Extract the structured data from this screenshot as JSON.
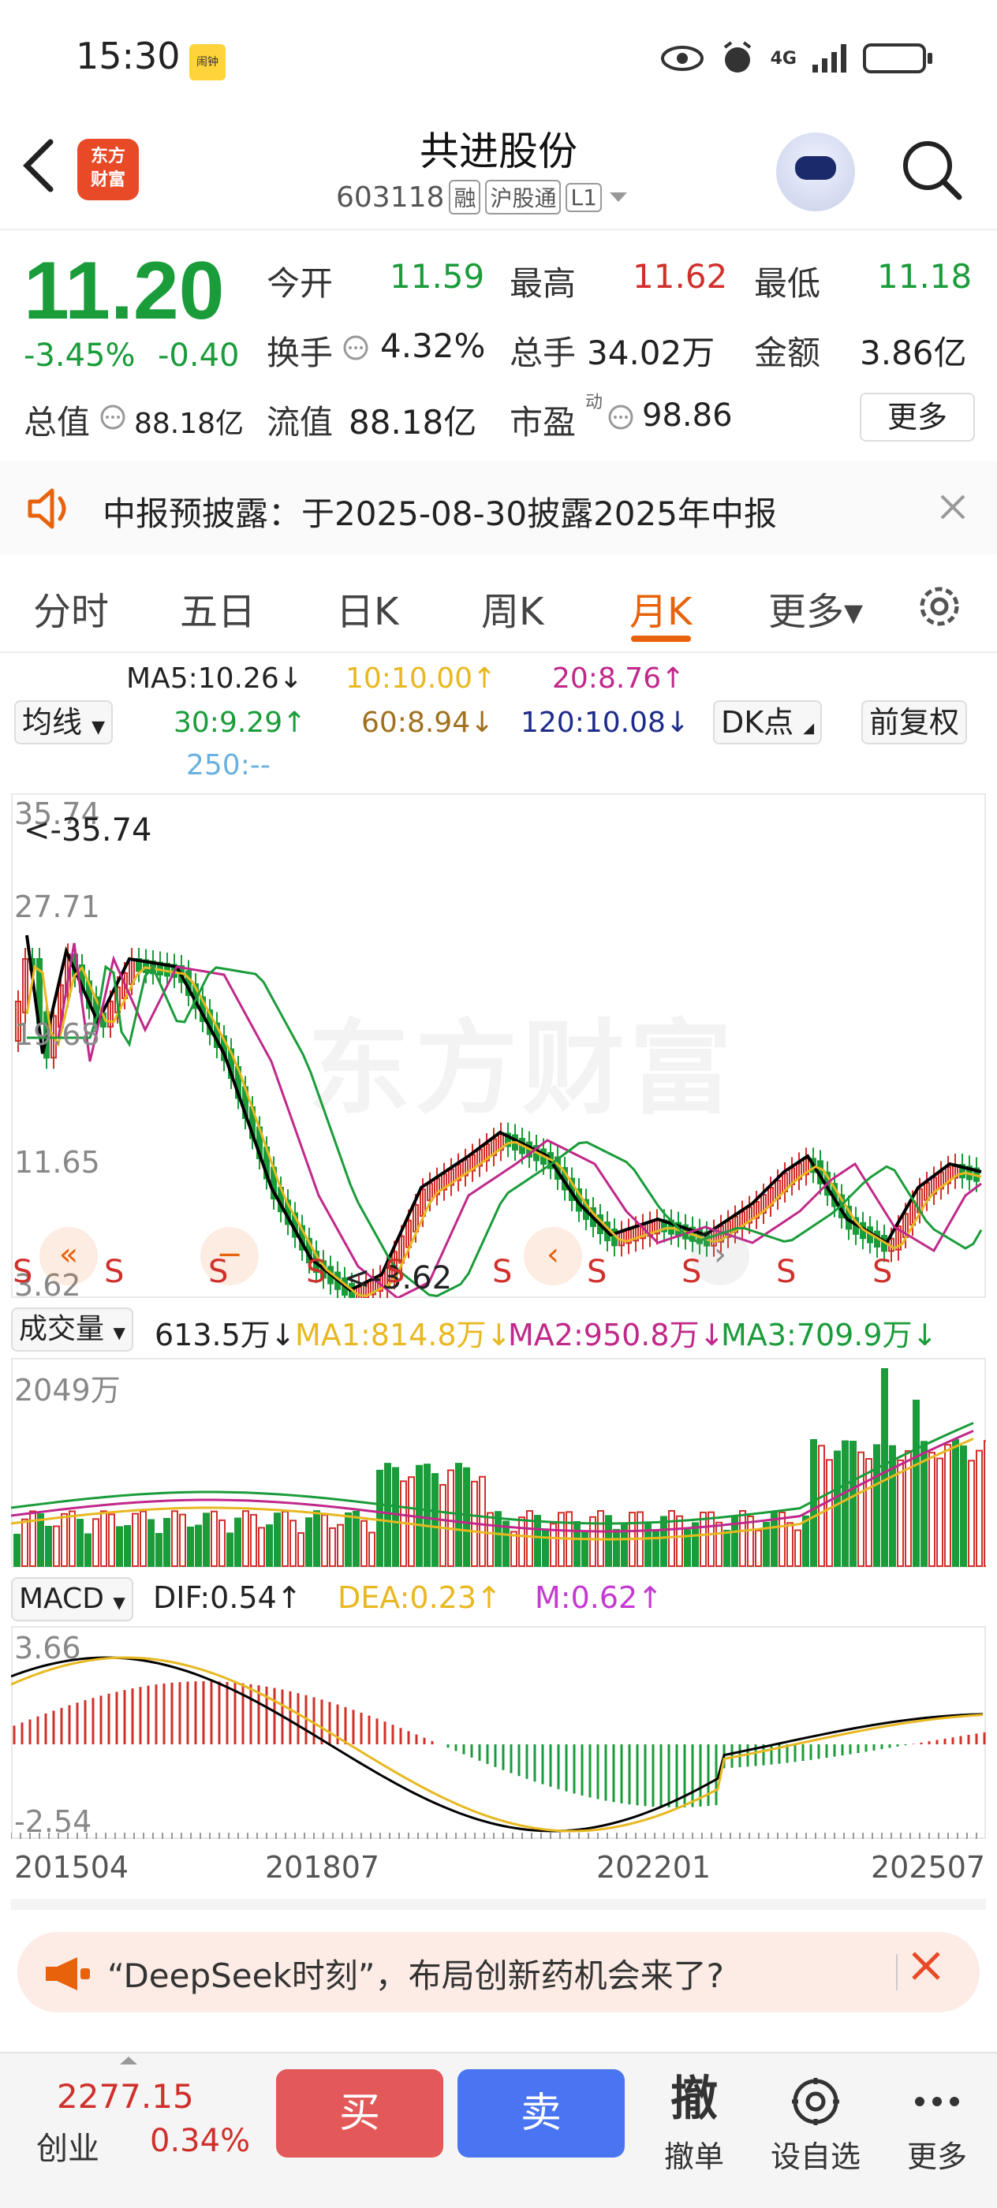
{
  "status": {
    "time": "15:30",
    "badge": "闹钟",
    "network": "4G"
  },
  "header": {
    "logo": [
      "东方",
      "财富"
    ],
    "name": "共进股份",
    "code": "603118",
    "tags": [
      "融",
      "沪股通",
      "L1"
    ]
  },
  "quote": {
    "price": "11.20",
    "change_pct": "-3.45%",
    "change": "-0.40",
    "open_label": "今开",
    "open": "11.59",
    "high_label": "最高",
    "high": "11.62",
    "low_label": "最低",
    "low": "11.18",
    "turnover_label": "换手",
    "turnover": "4.32%",
    "volume_label": "总手",
    "volume": "34.02万",
    "amount_label": "金额",
    "amount": "3.86亿",
    "mktcap_label": "总值",
    "mktcap": "88.18亿",
    "float_label": "流值",
    "float": "88.18亿",
    "pe_label": "市盈",
    "pe_sup": "动",
    "pe": "98.86",
    "more": "更多"
  },
  "notice": {
    "text": "中报预披露：于2025-08-30披露2025年中报"
  },
  "tabs": [
    "分时",
    "五日",
    "日K",
    "周K",
    "月K",
    "更多▾"
  ],
  "active_tab": "月K",
  "ma": {
    "selector": "均线",
    "ma5": "MA5:10.26↓",
    "ma10": "10:10.00↑",
    "ma20": "20:8.76↑",
    "ma30": "30:9.29↑",
    "ma60": "60:8.94↓",
    "ma120": "120:10.08↓",
    "ma250": "250:--",
    "dk": "DK点",
    "adjust": "前复权"
  },
  "kline": {
    "y_max": "35.74",
    "y_2": "27.71",
    "y_3": "19.68",
    "y_4": "11.65",
    "y_min": "3.62",
    "max_marker": "<-35.74",
    "min_marker": "<-3.62",
    "watermark": "东方财富",
    "signal": "S"
  },
  "volume": {
    "selector": "成交量",
    "value": "613.5万↓",
    "ma1": "MA1:814.8万↓",
    "ma2": "MA2:950.8万↓",
    "ma3": "MA3:709.9万↓",
    "y_max": "2049万"
  },
  "macd": {
    "selector": "MACD",
    "dif": "DIF:0.54↑",
    "dea": "DEA:0.23↑",
    "m": "M:0.62↑",
    "y_max": "3.66",
    "y_min": "-2.54"
  },
  "x_axis": [
    "201504",
    "201807",
    "202201",
    "202507"
  ],
  "ad": {
    "text": "“DeepSeek时刻”，布局创新药机会来了?"
  },
  "bottom": {
    "index_value": "2277.15",
    "index_name": "创业",
    "index_pct": "0.34%",
    "buy": "买",
    "sell": "卖",
    "cancel_icon": "撤",
    "cancel": "撤单",
    "watch": "设自选",
    "more": "更多"
  },
  "colors": {
    "up": "#d0302b",
    "down": "#1a9c3a",
    "accent": "#e8620c",
    "ma5": "#000000",
    "ma10": "#e8b820",
    "ma20": "#c0288a",
    "ma30": "#1a9c3a",
    "ma60": "#a0701e",
    "ma120": "#1d2b8a"
  }
}
